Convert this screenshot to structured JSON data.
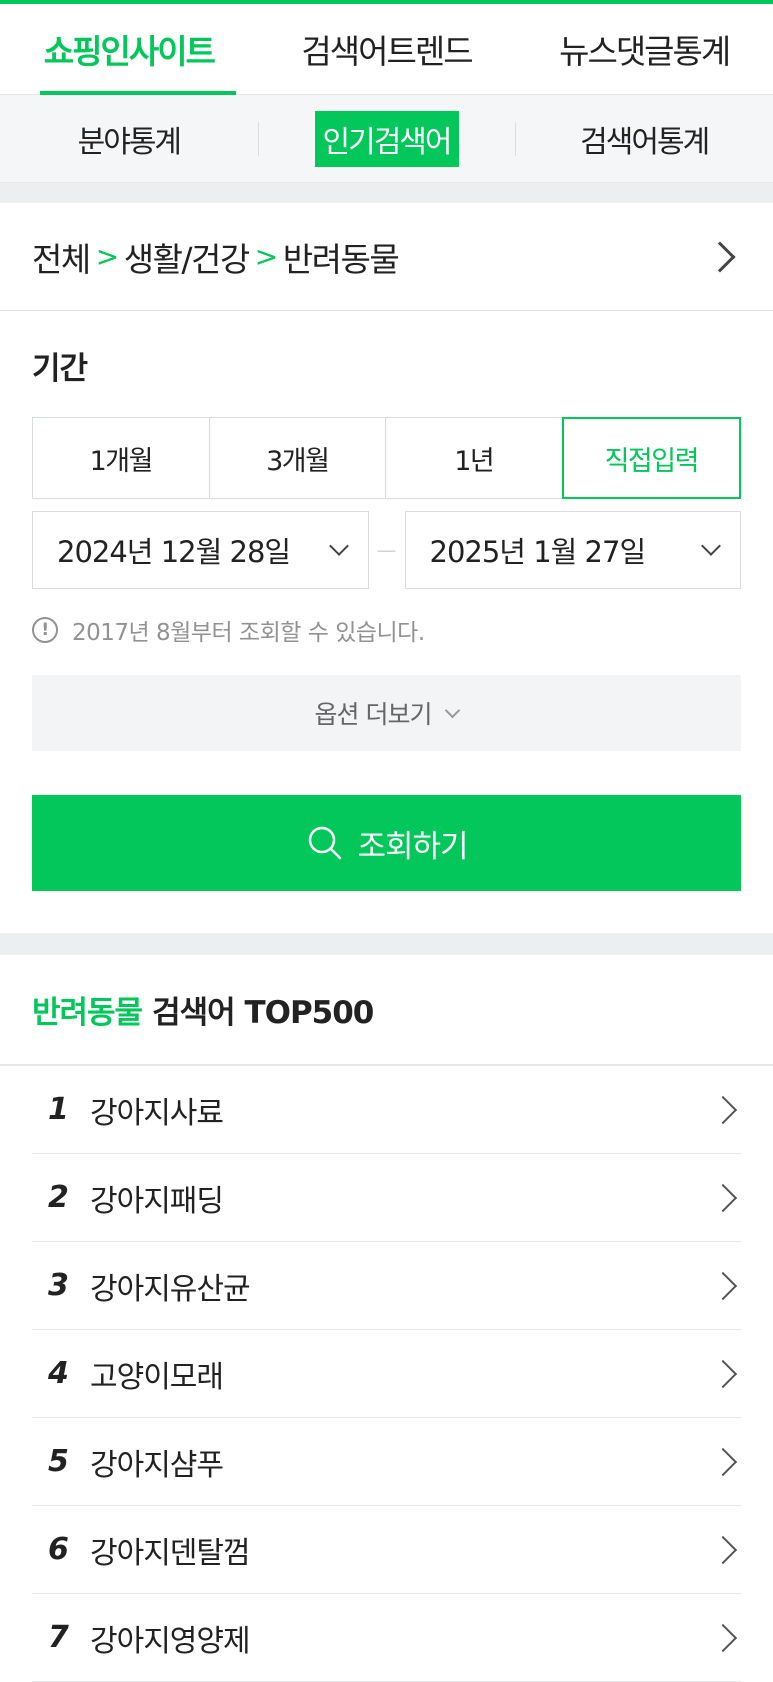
{
  "main_tabs": [
    "쇼핑인사이트",
    "검색어트렌드",
    "뉴스댓글통계"
  ],
  "sub_tabs": [
    "분야통계",
    "인기검색어",
    "검색어통계"
  ],
  "breadcrumb": [
    "전체",
    "생활/건강",
    "반려동물"
  ],
  "period": {
    "title": "기간",
    "buttons": [
      "1개월",
      "3개월",
      "1년",
      "직접입력"
    ],
    "start_date": "2024년 12월 28일",
    "end_date": "2025년 1월 27일",
    "notice": "2017년 8월부터 조회할 수 있습니다.",
    "more_label": "옵션 더보기",
    "search_label": "조회하기"
  },
  "top": {
    "category": "반려동물",
    "title_rest": "검색어 TOP500",
    "items": [
      {
        "rank": "1",
        "keyword": "강아지사료"
      },
      {
        "rank": "2",
        "keyword": "강아지패딩"
      },
      {
        "rank": "3",
        "keyword": "강아지유산균"
      },
      {
        "rank": "4",
        "keyword": "고양이모래"
      },
      {
        "rank": "5",
        "keyword": "강아지샴푸"
      },
      {
        "rank": "6",
        "keyword": "강아지덴탈껌"
      },
      {
        "rank": "7",
        "keyword": "강아지영양제"
      }
    ]
  },
  "colors": {
    "accent": "#03c75a"
  }
}
